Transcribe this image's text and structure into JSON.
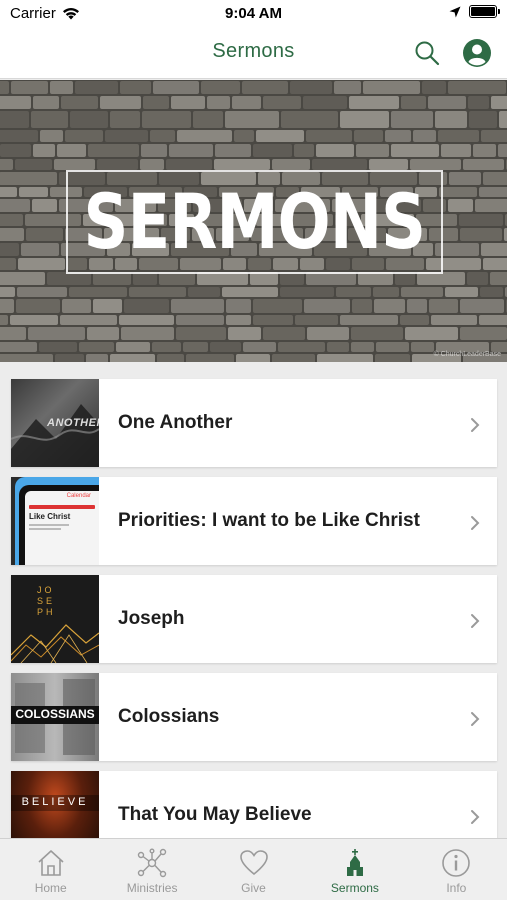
{
  "status_bar": {
    "carrier": "Carrier",
    "time": "9:04 AM"
  },
  "nav": {
    "title": "Sermons"
  },
  "hero": {
    "title": "SERMONS",
    "credit": "© ChurchLeaderBase"
  },
  "sermons": [
    {
      "title": "One Another",
      "thumb_text": "ANOTHER"
    },
    {
      "title": "Priorities: I want to be Like Christ",
      "thumb_text": "Like Christ",
      "thumb_header": "Calendar"
    },
    {
      "title": "Joseph",
      "thumb_text": "JOSEPH"
    },
    {
      "title": "Colossians",
      "thumb_text": "COLOSSIANS"
    },
    {
      "title": "That You May Believe",
      "thumb_text": "BELIEVE"
    }
  ],
  "tabs": [
    {
      "label": "Home",
      "icon": "home-icon"
    },
    {
      "label": "Ministries",
      "icon": "network-icon"
    },
    {
      "label": "Give",
      "icon": "heart-icon"
    },
    {
      "label": "Sermons",
      "icon": "church-icon"
    },
    {
      "label": "Info",
      "icon": "info-icon"
    }
  ],
  "colors": {
    "accent": "#2e6b45",
    "tab_inactive": "#9a9a9a"
  }
}
